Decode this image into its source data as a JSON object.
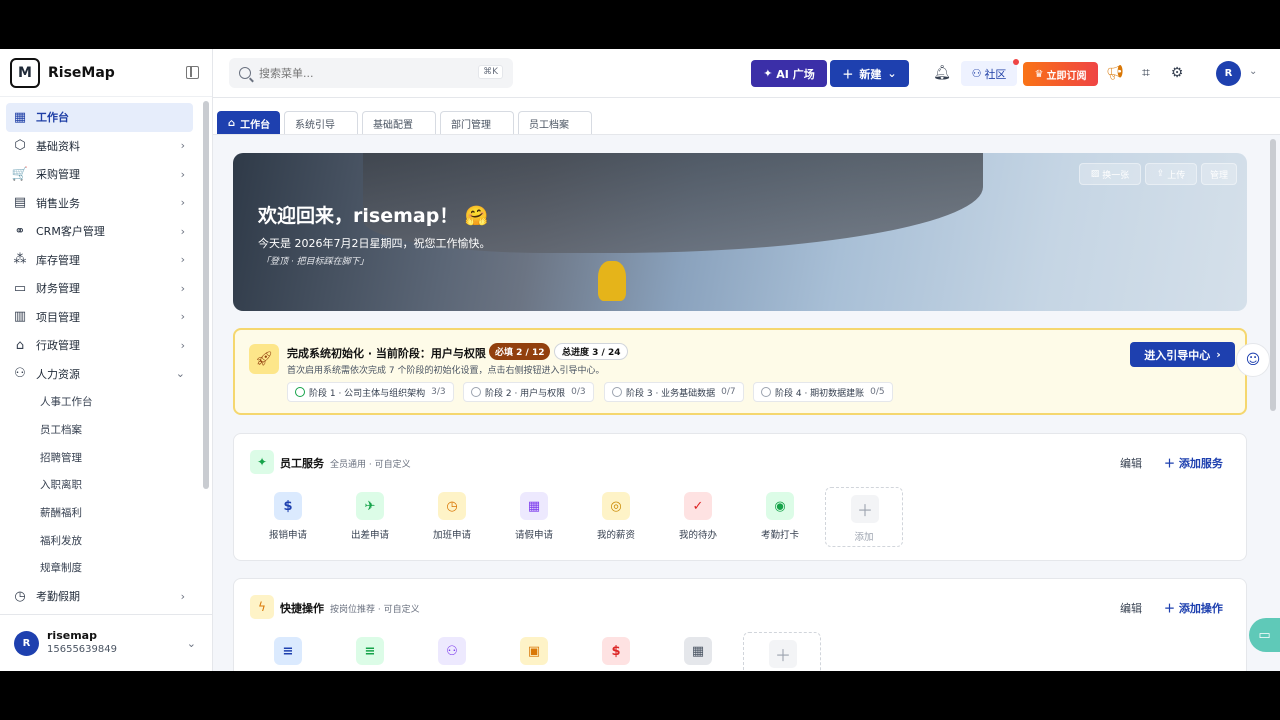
{
  "brand": {
    "name": "RiseMap",
    "logo": "M"
  },
  "search": {
    "placeholder": "搜索菜单...",
    "shortcut": "⌘K"
  },
  "header": {
    "ai_label": "AI 广场",
    "new_label": "新建",
    "community_label": "社区",
    "subscribe_label": "立即订阅",
    "avatar_letter": "R"
  },
  "sidebar": {
    "items": [
      {
        "label": "工作台",
        "icon": "dashboard-icon",
        "active": true
      },
      {
        "label": "基础资料",
        "icon": "box-icon"
      },
      {
        "label": "采购管理",
        "icon": "cart-icon"
      },
      {
        "label": "销售业务",
        "icon": "document-icon"
      },
      {
        "label": "CRM客户管理",
        "icon": "handshake-icon"
      },
      {
        "label": "库存管理",
        "icon": "boxes-icon"
      },
      {
        "label": "财务管理",
        "icon": "wallet-icon"
      },
      {
        "label": "项目管理",
        "icon": "calendar-icon"
      },
      {
        "label": "行政管理",
        "icon": "building-icon"
      },
      {
        "label": "人力资源",
        "icon": "users-icon",
        "expanded": true
      }
    ],
    "sub_items": [
      "人事工作台",
      "员工档案",
      "招聘管理",
      "入职离职",
      "薪酬福利",
      "福利发放",
      "规章制度"
    ],
    "last_item": {
      "label": "考勤假期",
      "icon": "clock-icon"
    },
    "user": {
      "name": "risemap",
      "phone": "15655639849",
      "avatar_letter": "R"
    }
  },
  "tabs": [
    {
      "label": "工作台",
      "active": true
    },
    {
      "label": "系统引导"
    },
    {
      "label": "基础配置"
    },
    {
      "label": "部门管理"
    },
    {
      "label": "员工档案"
    }
  ],
  "hero": {
    "title": "欢迎回来，risemap！ 🤗",
    "subtitle": "今天是 2026年7月2日星期四，祝您工作愉快。",
    "quote": "「登顶 · 把目标踩在脚下」",
    "btn_change": "换一张",
    "btn_upload": "上传",
    "btn_manage": "管理"
  },
  "setup": {
    "title": "完成系统初始化 · 当前阶段：用户与权限",
    "required_badge": "必填 2 / 12",
    "total_badge": "总进度 3 / 24",
    "description": "首次启用系统需依次完成 7 个阶段的初始化设置，点击右侧按钮进入引导中心。",
    "stages": [
      {
        "label": "阶段 1 · 公司主体与组织架构",
        "count": "3/3",
        "done": true
      },
      {
        "label": "阶段 2 · 用户与权限",
        "count": "0/3"
      },
      {
        "label": "阶段 3 · 业务基础数据",
        "count": "0/7"
      },
      {
        "label": "阶段 4 · 期初数据建账",
        "count": "0/5"
      }
    ],
    "guide_button": "进入引导中心"
  },
  "employee_services": {
    "title": "员工服务",
    "subtitle": "全员通用 · 可自定义",
    "edit_label": "编辑",
    "add_label": "添加服务",
    "items": [
      {
        "label": "报销申请",
        "glyph": "$",
        "bg": "#dbeafe",
        "fg": "#1e40af"
      },
      {
        "label": "出差申请",
        "glyph": "✈",
        "bg": "#dcfce7",
        "fg": "#16a34a"
      },
      {
        "label": "加班申请",
        "glyph": "◷",
        "bg": "#fef3c7",
        "fg": "#d97706"
      },
      {
        "label": "请假申请",
        "glyph": "▦",
        "bg": "#ede9fe",
        "fg": "#7c3aed"
      },
      {
        "label": "我的薪资",
        "glyph": "◎",
        "bg": "#fef3c7",
        "fg": "#ca8a04"
      },
      {
        "label": "我的待办",
        "glyph": "✓",
        "bg": "#fee2e2",
        "fg": "#dc2626"
      },
      {
        "label": "考勤打卡",
        "glyph": "◉",
        "bg": "#dcfce7",
        "fg": "#16a34a"
      }
    ],
    "add_item_label": "添加"
  },
  "quick_actions": {
    "title": "快捷操作",
    "subtitle": "按岗位推荐 · 可自定义",
    "edit_label": "编辑",
    "add_label": "添加操作",
    "items": [
      {
        "glyph": "≡",
        "bg": "#dbeafe",
        "fg": "#1e40af"
      },
      {
        "glyph": "≡",
        "bg": "#dcfce7",
        "fg": "#16a34a"
      },
      {
        "glyph": "⚇",
        "bg": "#ede9fe",
        "fg": "#7c3aed"
      },
      {
        "glyph": "▣",
        "bg": "#fef3c7",
        "fg": "#d97706"
      },
      {
        "glyph": "$",
        "bg": "#fee2e2",
        "fg": "#dc2626"
      },
      {
        "glyph": "▦",
        "bg": "#e5e7eb",
        "fg": "#4b5563"
      }
    ]
  },
  "colors": {
    "primary": "#1e40af",
    "ai": "#3b2fa8",
    "accent_orange": "#f97316",
    "setup_bg": "#fefbe8"
  }
}
